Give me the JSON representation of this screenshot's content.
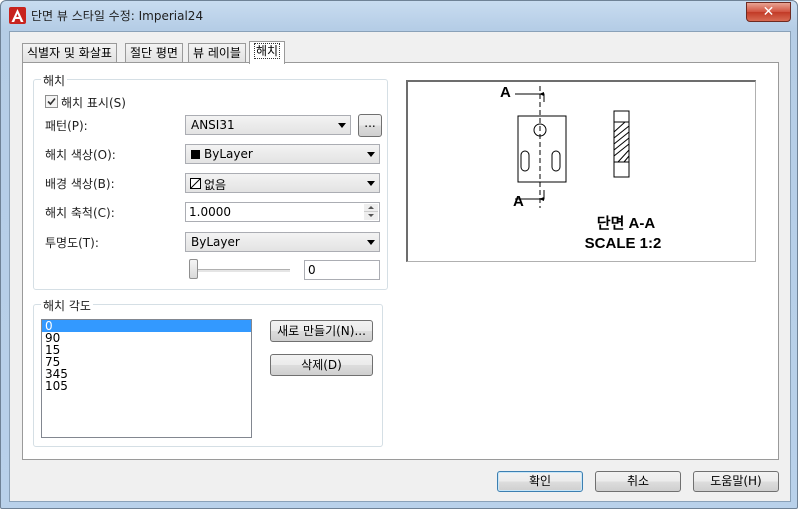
{
  "window": {
    "title": "단면 뷰 스타일 수정: Imperial24",
    "close_glyph": "✕"
  },
  "tabs": [
    {
      "label": "식별자 및 화살표"
    },
    {
      "label": "절단 평면"
    },
    {
      "label": "뷰 레이블"
    },
    {
      "label": "해치",
      "active": true
    }
  ],
  "hatch_group": {
    "title": "해치",
    "show_hatch": {
      "label": "해치 표시(S)",
      "checked": true
    },
    "pattern": {
      "label": "패턴(P):",
      "value": "ANSI31",
      "browse_label": "..."
    },
    "hatch_color": {
      "label": "해치 색상(O):",
      "value": "ByLayer"
    },
    "bg_color": {
      "label": "배경 색상(B):",
      "value": "없음"
    },
    "hatch_scale": {
      "label": "해치 축척(C):",
      "value": "1.0000"
    },
    "transparency": {
      "label": "투명도(T):",
      "value": "ByLayer",
      "slider_value": "0",
      "slider_level": 0
    }
  },
  "angle_group": {
    "title": "해치 각도",
    "angles": [
      "0",
      "90",
      "15",
      "75",
      "345",
      "105"
    ],
    "selected_index": 0,
    "new_button": "새로 만들기(N)...",
    "delete_button": "삭제(D)"
  },
  "preview": {
    "label_a_top": "A",
    "label_a_bottom": "A",
    "caption_line1": "단면 A-A",
    "caption_line2": "SCALE 1:2"
  },
  "footer": {
    "ok": "확인",
    "cancel": "취소",
    "help": "도움말(H)"
  }
}
